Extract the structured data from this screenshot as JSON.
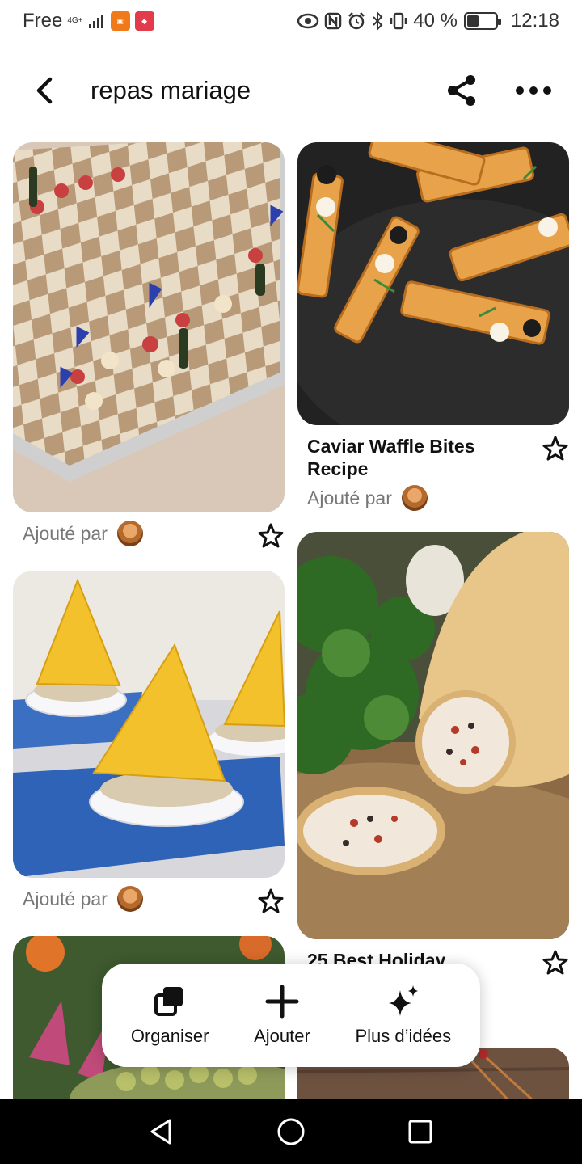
{
  "status_bar": {
    "carrier": "Free",
    "network": "4G+",
    "battery": "40 %",
    "battery_level": 0.4,
    "time": "12:18"
  },
  "header": {
    "title": "repas mariage",
    "back_icon": "chevron-left-icon",
    "share_icon": "share-icon",
    "more_icon": "more-horizontal-icon"
  },
  "pins": [
    {
      "title": "",
      "added_by": "Ajouté par"
    },
    {
      "title": "Caviar Waffle Bites Recipe",
      "added_by": "Ajouté par"
    },
    {
      "title": "",
      "added_by": "Ajouté par"
    },
    {
      "title": "25 Best Holiday",
      "added_by": ""
    }
  ],
  "action_bar": {
    "organize": "Organiser",
    "add": "Ajouter",
    "more_ideas": "Plus d’idées"
  },
  "colors": {
    "text_primary": "#111111",
    "text_secondary": "#777777",
    "background": "#ffffff"
  }
}
